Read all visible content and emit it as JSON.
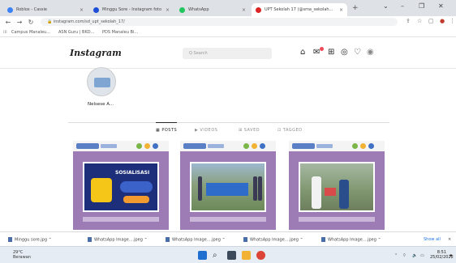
{
  "browser": {
    "tabs": [
      {
        "label": "Roblox - Cassie",
        "fav_color": "#3b82f6"
      },
      {
        "label": "Minggu Sore - Instagram foto",
        "fav_color": "#1d4ed8"
      },
      {
        "label": "WhatsApp",
        "fav_color": "#22c55e"
      },
      {
        "label": "UPT Sekolah 17 (@sma_sekolah...",
        "fav_color": "#dc2626"
      }
    ],
    "new_tab": "+",
    "window_controls": [
      "⌄",
      "–",
      "❐",
      "✕"
    ],
    "address": "instagram.com/sd_upt_sekolah_17/",
    "bookmarks": [
      "Campus Manaleu...",
      "ASN Guru | BKD...",
      "PDS Manaleu Bi..."
    ]
  },
  "instagram": {
    "logo": "Instagram",
    "search_placeholder": "Q  Search",
    "nav_icons": [
      "home-icon",
      "messenger-icon",
      "new-post-icon",
      "explore-icon",
      "heart-icon",
      "profile-icon"
    ],
    "profile": {
      "username": "Nelsese A..."
    },
    "profile_tabs": [
      "▦ POSTS",
      "▶ VIDEOS",
      "⊞ SAVED",
      "⊡ TAGGED"
    ],
    "posts": [
      {
        "type": "poster",
        "caption": "SOSIALISASI"
      },
      {
        "type": "photo"
      },
      {
        "type": "photo"
      }
    ]
  },
  "downloads": {
    "items": [
      {
        "name": "Minggu sore.jpg"
      },
      {
        "name": "WhatsApp Image....jpeg"
      },
      {
        "name": "WhatsApp Image....jpeg"
      },
      {
        "name": "WhatsApp Image....jpeg"
      },
      {
        "name": "WhatsApp Image....jpeg"
      }
    ],
    "show_all": "Show all"
  },
  "taskbar": {
    "weather_temp": "29°C",
    "weather_desc": "Berawan",
    "time": "8:51",
    "date": "25/02/2022"
  }
}
